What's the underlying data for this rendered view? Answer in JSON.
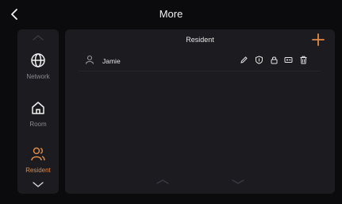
{
  "header": {
    "title": "More",
    "back_icon": "chevron-left-icon"
  },
  "sidebar": {
    "items": [
      {
        "label": "Network",
        "icon": "globe-icon",
        "active": false
      },
      {
        "label": "Room",
        "icon": "home-icon",
        "active": false
      },
      {
        "label": "Resident",
        "icon": "residents-icon",
        "active": true
      }
    ]
  },
  "panel": {
    "title": "Resident",
    "add_icon": "plus-icon",
    "residents": [
      {
        "name": "Jamie"
      }
    ],
    "row_actions": [
      "edit-icon",
      "shield-icon",
      "lock-icon",
      "card-icon",
      "delete-icon"
    ]
  },
  "colors": {
    "background": "#0b0b0d",
    "card": "#1b1b20",
    "accent": "#e08b47",
    "muted": "#8a8a90",
    "text": "#e9e9ea"
  }
}
